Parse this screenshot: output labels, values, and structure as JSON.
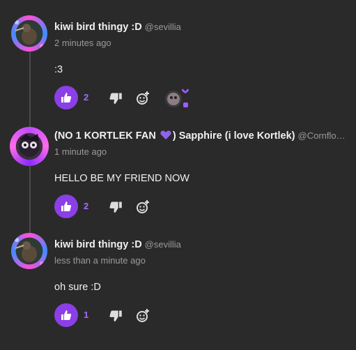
{
  "comments": [
    {
      "name": "kiwi bird thingy :D",
      "handle": "@sevillia",
      "time": "2 minutes ago",
      "body": ":3",
      "likes": "2"
    },
    {
      "name_part1": "(NO 1 KORTLEK FAN",
      "name_part2": ") Sapphire (i love Kortlek)",
      "handle": "@Cornflo…",
      "time": "1 minute ago",
      "body": "HELLO BE MY FRIEND NOW",
      "likes": "2"
    },
    {
      "name": "kiwi bird thingy :D",
      "handle": "@sevillia",
      "time": "less than a minute ago",
      "body": "oh sure :D",
      "likes": "1"
    }
  ],
  "colors": {
    "background": "#2a2a2a",
    "accent": "#8b3fe6",
    "muted": "#9a9a9a"
  },
  "icons": {
    "like": "thumbs-up-icon",
    "dislike": "thumbs-down-icon",
    "react": "add-reaction-icon",
    "name_emoji": "purple-heart-icon"
  }
}
